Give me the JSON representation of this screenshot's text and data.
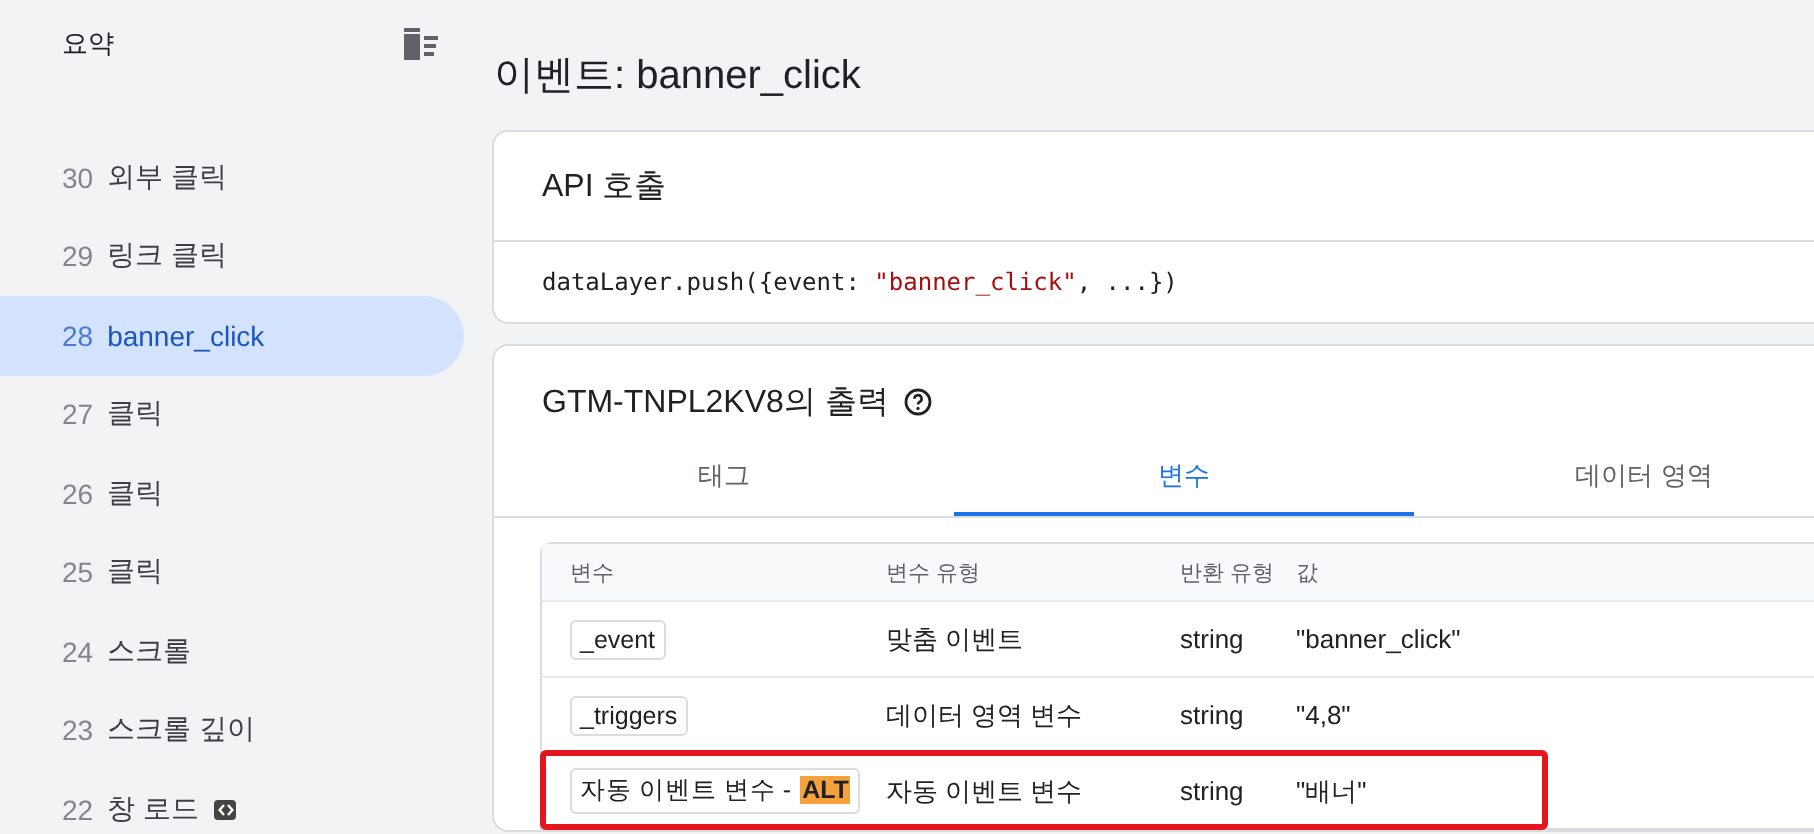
{
  "sidebar": {
    "title": "요약",
    "items": [
      {
        "number": "30",
        "label": "외부 클릭",
        "selected": false
      },
      {
        "number": "29",
        "label": "링크 클릭",
        "selected": false
      },
      {
        "number": "28",
        "label": "banner_click",
        "selected": true
      },
      {
        "number": "27",
        "label": "클릭",
        "selected": false
      },
      {
        "number": "26",
        "label": "클릭",
        "selected": false
      },
      {
        "number": "25",
        "label": "클릭",
        "selected": false
      },
      {
        "number": "24",
        "label": "스크롤",
        "selected": false
      },
      {
        "number": "23",
        "label": "스크롤 깊이",
        "selected": false
      },
      {
        "number": "22",
        "label": "창 로드",
        "selected": false,
        "kind": "code"
      }
    ]
  },
  "page_title": "이벤트: banner_click",
  "api_card": {
    "title": "API 호출",
    "code_prefix": "dataLayer.push({event: ",
    "code_string": "\"banner_click\"",
    "code_suffix": ", ...})"
  },
  "output_card": {
    "title": "GTM-TNPL2KV8의 출력",
    "tabs": [
      {
        "label": "태그",
        "selected": false
      },
      {
        "label": "변수",
        "selected": true
      },
      {
        "label": "데이터 영역",
        "selected": false
      }
    ],
    "table": {
      "columns": [
        "변수",
        "변수 유형",
        "반환 유형",
        "값"
      ],
      "rows": [
        {
          "name": "_event",
          "type": "맞춤 이벤트",
          "return_type": "string",
          "value": "\"banner_click\"",
          "outlined": false
        },
        {
          "name": "_triggers",
          "type": "데이터 영역 변수",
          "return_type": "string",
          "value": "\"4,8\"",
          "outlined": false
        },
        {
          "name": "자동 이벤트 변수 - **ALT**",
          "type": "자동 이벤트 변수",
          "return_type": "string",
          "value": "\"배너\"",
          "outlined": true
        }
      ]
    }
  }
}
